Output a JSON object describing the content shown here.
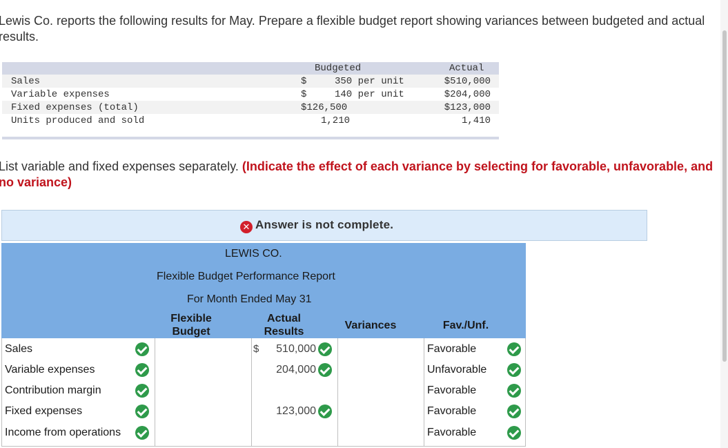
{
  "intro": "Lewis Co. reports the following results for May. Prepare a flexible budget report showing variances between budgeted and actual results.",
  "given": {
    "col_budgeted": "Budgeted",
    "col_actual": "Actual",
    "rows": [
      {
        "label": "Sales",
        "budget_sign": "$",
        "budget": "350 per unit",
        "actual": "$510,000"
      },
      {
        "label": "Variable expenses",
        "budget_sign": "$",
        "budget": "140 per unit",
        "actual": "$204,000"
      },
      {
        "label": "Fixed expenses (total)",
        "budget_sign": "",
        "budget": "$126,500",
        "actual": "$123,000"
      },
      {
        "label": "Units produced and sold",
        "budget_sign": "",
        "budget": "1,210",
        "actual": "1,410"
      }
    ]
  },
  "instructions_plain": "List variable and fixed expenses separately. ",
  "instructions_bold": "(Indicate the effect of each variance by selecting  for favorable, unfavorable, and no variance)",
  "banner": "Answer is not complete.",
  "report": {
    "company": "LEWIS CO.",
    "title": "Flexible Budget Performance Report",
    "period": "For Month Ended May 31",
    "col_flexible_1": "Flexible",
    "col_flexible_2": "Budget",
    "col_actual_1": "Actual",
    "col_actual_2": "Results",
    "col_variances": "Variances",
    "col_fav": "Fav./Unf.",
    "dollar": "$",
    "rows": [
      {
        "label": "Sales",
        "actual": "510,000",
        "fav": "Favorable"
      },
      {
        "label": "Variable expenses",
        "actual": "204,000",
        "fav": "Unfavorable"
      },
      {
        "label": "Contribution margin",
        "actual": "",
        "fav": "Favorable"
      },
      {
        "label": "Fixed expenses",
        "actual": "123,000",
        "fav": "Favorable"
      },
      {
        "label": "Income from operations",
        "actual": "",
        "fav": "Favorable"
      }
    ]
  }
}
